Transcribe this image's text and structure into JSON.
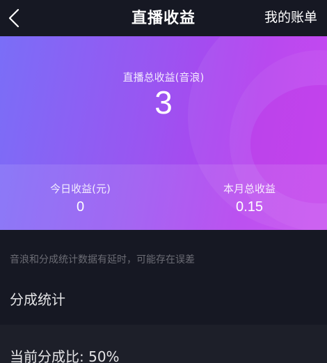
{
  "header": {
    "title": "直播收益",
    "right_link": "我的账单",
    "back_icon": "chevron-left-icon"
  },
  "summary": {
    "total_label": "直播总收益(音浪)",
    "total_value": "3",
    "today_label": "今日收益(元)",
    "today_value": "0",
    "month_label": "本月总收益",
    "month_value": "0.15"
  },
  "notice": "音浪和分成统计数据有延时，可能存在误差",
  "section": {
    "title": "分成统计",
    "ratio_text": "当前分成比: 50%"
  },
  "colors": {
    "background": "#161823",
    "gradient_start": "#7a6ef7",
    "gradient_end": "#c43df0"
  }
}
